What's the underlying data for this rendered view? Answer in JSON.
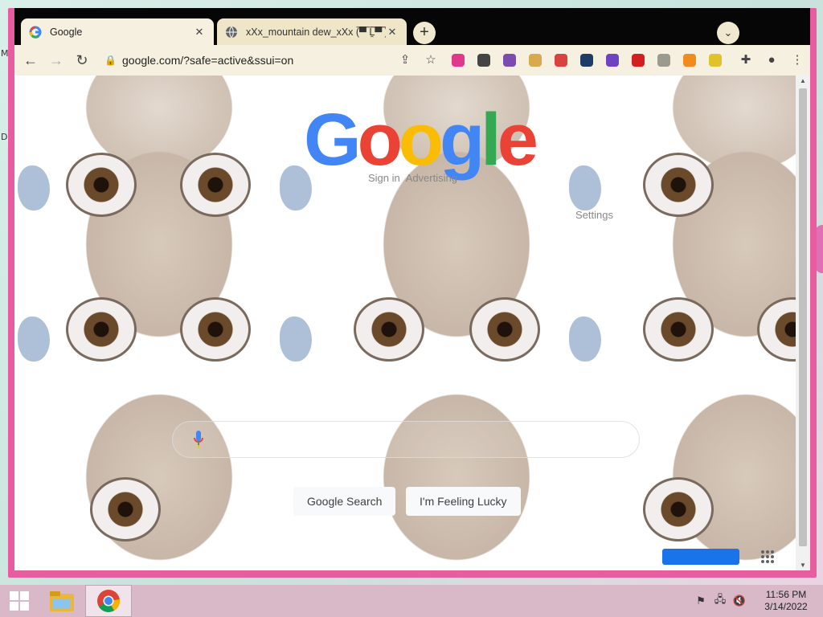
{
  "desktop": {
    "marks": [
      "M",
      "D"
    ]
  },
  "browser": {
    "tabs": [
      {
        "title": "Google",
        "favicon": "google-g-icon"
      },
      {
        "title": "xXx_mountain dew_xXx (̿▀̿ ̿Ĺ̯̿̿▀̿ ̿)̄ Er",
        "favicon": "globe-icon"
      }
    ],
    "close_glyph": "✕",
    "new_tab_glyph": "+",
    "tab_search_glyph": "⌄",
    "nav": {
      "back": "←",
      "forward": "→",
      "reload": "↻"
    },
    "address": "google.com/?safe=active&ssui=on",
    "omni_actions": {
      "share": "⇪",
      "bookmark": "☆"
    },
    "extensions": [
      {
        "name": "rainbow-flag-ext-icon",
        "color": "#e0388a"
      },
      {
        "name": "hat-ext-icon",
        "color": "#444444"
      },
      {
        "name": "monster-ext-icon",
        "color": "#7b4bb0"
      },
      {
        "name": "doge-ext-icon",
        "color": "#d8a94f"
      },
      {
        "name": "palette-ext-icon",
        "color": "#d9433f"
      },
      {
        "name": "crosshair-ext-icon",
        "color": "#1d3d66"
      },
      {
        "name": "burst-ext-icon",
        "color": "#6f42c1"
      },
      {
        "name": "block-ext-icon",
        "color": "#d21f1f"
      },
      {
        "name": "skull-ext-icon",
        "color": "#9a9a8f"
      },
      {
        "name": "sun-ext-icon",
        "color": "#f28b1e"
      },
      {
        "name": "bee-ext-icon",
        "color": "#e2c22b"
      }
    ],
    "toolbar_right": {
      "puzzle": "✚",
      "profile": "●",
      "menu": "⋮"
    }
  },
  "google": {
    "logo_letters": [
      {
        "ch": "G",
        "color": "#4285f4"
      },
      {
        "ch": "o",
        "color": "#ea4335"
      },
      {
        "ch": "o",
        "color": "#fbbc05"
      },
      {
        "ch": "g",
        "color": "#4285f4"
      },
      {
        "ch": "l",
        "color": "#34a853"
      },
      {
        "ch": "e",
        "color": "#ea4335"
      }
    ],
    "top_links": [
      "Sign in",
      "Advertising"
    ],
    "settings": "Settings",
    "buttons": {
      "search": "Google Search",
      "lucky": "I'm Feeling Lucky"
    }
  },
  "taskbar": {
    "apps": [
      {
        "name": "file-explorer-icon",
        "active": false
      },
      {
        "name": "chrome-icon",
        "active": true
      }
    ],
    "time": "11:56 PM",
    "date": "3/14/2022"
  }
}
